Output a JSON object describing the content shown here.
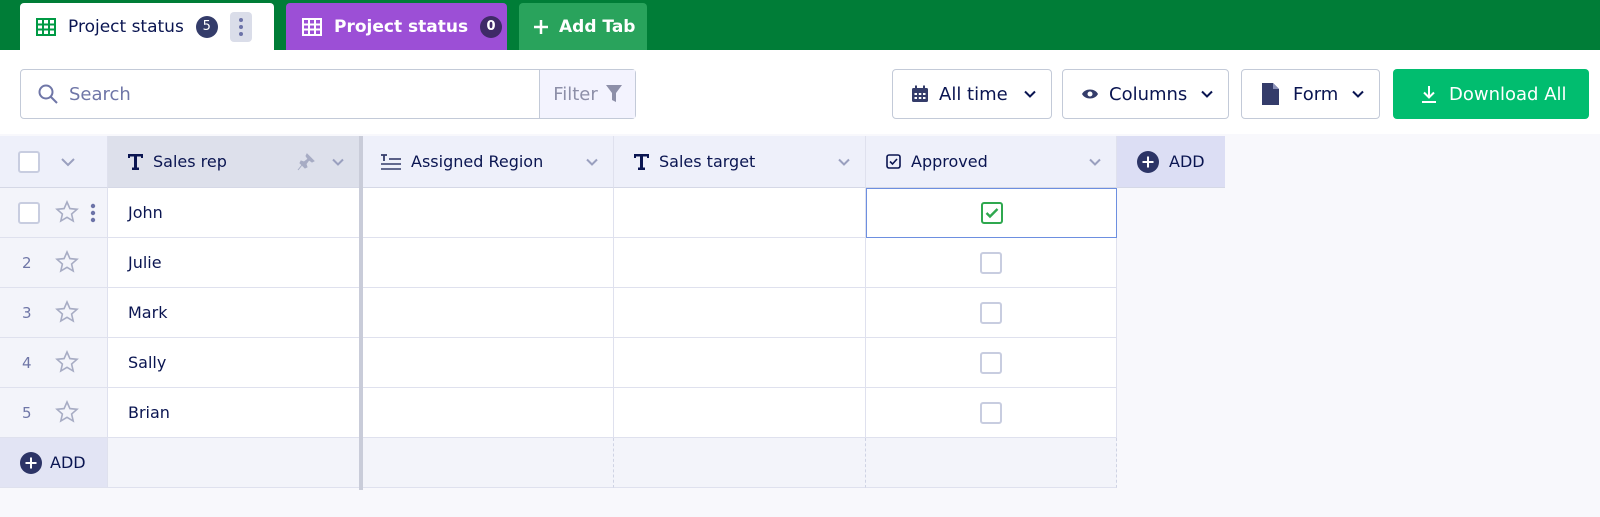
{
  "tabs": [
    {
      "label": "Project status",
      "count": "5",
      "icon": "table-icon",
      "active": true
    },
    {
      "label": "Project status",
      "count": "0",
      "icon": "table-icon",
      "color": "#9c4fd6"
    }
  ],
  "add_tab_label": "Add Tab",
  "colors": {
    "brand_green": "#007d37",
    "download": "#01bd6f",
    "tab2": "#9c4fd6"
  },
  "toolbar": {
    "search_placeholder": "Search",
    "filter_label": "Filter",
    "date_label": "All time",
    "columns_label": "Columns",
    "form_label": "Form",
    "download_label": "Download All"
  },
  "table": {
    "columns": [
      {
        "label": "Sales rep",
        "icon": "text-type-icon"
      },
      {
        "label": "Assigned Region",
        "icon": "long-text-icon"
      },
      {
        "label": "Sales target",
        "icon": "text-type-icon"
      },
      {
        "label": "Approved",
        "icon": "checkbox-icon"
      }
    ],
    "add_column_label": "ADD",
    "rows": [
      {
        "num": "",
        "sales_rep": "John",
        "region": "",
        "target": "",
        "approved": true
      },
      {
        "num": "2",
        "sales_rep": "Julie",
        "region": "",
        "target": "",
        "approved": false
      },
      {
        "num": "3",
        "sales_rep": "Mark",
        "region": "",
        "target": "",
        "approved": false
      },
      {
        "num": "4",
        "sales_rep": "Sally",
        "region": "",
        "target": "",
        "approved": false
      },
      {
        "num": "5",
        "sales_rep": "Brian",
        "region": "",
        "target": "",
        "approved": false
      }
    ],
    "add_row_label": "ADD"
  }
}
